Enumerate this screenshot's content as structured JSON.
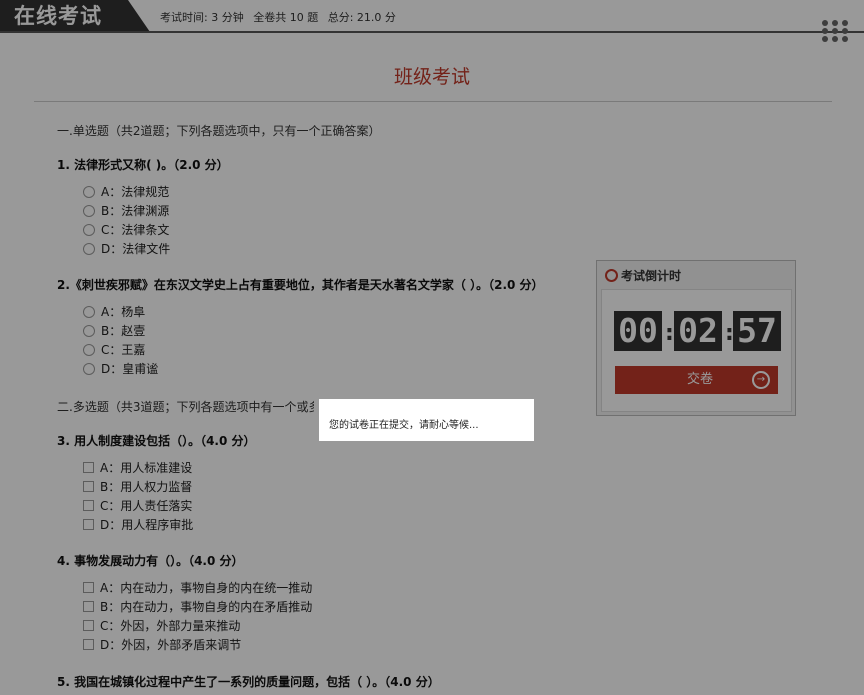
{
  "header": {
    "brand": "在线考试",
    "time_label": "考试时间: 3 分钟",
    "total_label": "全卷共 10 题",
    "score_label": "总分: 21.0 分"
  },
  "page_title": "班级考试",
  "sections": {
    "single": "一.单选题（共2道题；下列各题选项中，只有一个正确答案）",
    "multi": "二.多选题（共3道题；下列各题选项中有一个或多"
  },
  "questions": [
    {
      "stem": "1. 法律形式又称( )。（2.0 分）",
      "options": [
        "A：法律规范",
        "B：法律渊源",
        "C：法律条文",
        "D：法律文件"
      ]
    },
    {
      "stem": "2.《刺世疾邪赋》在东汉文学史上占有重要地位，其作者是天水著名文学家（ ）。（2.0 分）",
      "options": [
        "A：杨阜",
        "B：赵壹",
        "C：王嘉",
        "D：皇甫谧"
      ]
    },
    {
      "stem": "3. 用人制度建设包括（）。（4.0 分）",
      "options": [
        "A：用人标准建设",
        "B：用人权力监督",
        "C：用人责任落实",
        "D：用人程序审批"
      ]
    },
    {
      "stem": "4. 事物发展动力有（）。（4.0 分）",
      "options": [
        "A：内在动力，事物自身的内在统一推动",
        "B：内在动力，事物自身的内在矛盾推动",
        "C：外因，外部力量来推动",
        "D：外因，外部矛盾来调节"
      ]
    },
    {
      "stem": "5. 我国在城镇化过程中产生了一系列的质量问题，包括（ ）。（4.0 分）",
      "options": []
    }
  ],
  "timer": {
    "title": "考试倒计时",
    "hours": "00",
    "minutes": "02",
    "seconds": "57",
    "submit_label": "交卷"
  },
  "modal": {
    "message": "您的试卷正在提交，请耐心等候..."
  },
  "colors": {
    "accent": "#c0392b",
    "brand_bg": "#333333",
    "digit_bg": "#333333"
  }
}
